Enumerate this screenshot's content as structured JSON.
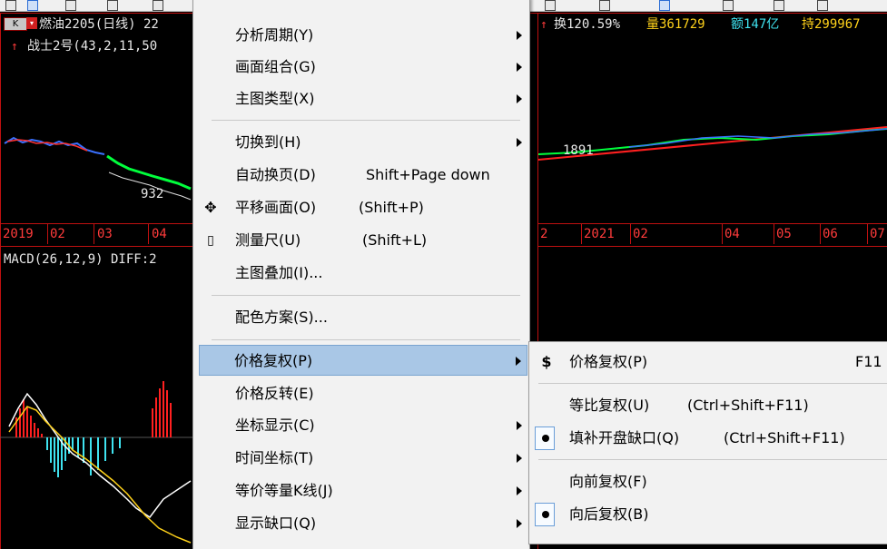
{
  "chart": {
    "kbadge": "K",
    "title_left": "燃油2205(日线) 22",
    "indicator_left": "战士2号(43,2,11,50",
    "stat_turnover": "换120.59%",
    "stat_volume": "量361729",
    "stat_amount": "额147亿",
    "stat_hold": "持299967",
    "price_low_label": "932",
    "price_label_right": "1891",
    "dates_left": [
      "2019",
      "02",
      "03",
      "04"
    ],
    "dates_right": [
      "2",
      "2021",
      "02",
      "04",
      "05",
      "06",
      "07"
    ],
    "macd_label": "MACD(26,12,9) DIFF:2"
  },
  "menu": {
    "items": [
      {
        "label": "分析周期(Y)",
        "submenu": true
      },
      {
        "label": "画面组合(G)",
        "submenu": true
      },
      {
        "label": "主图类型(X)",
        "submenu": true
      },
      {
        "label": "切换到(H)",
        "submenu": true
      },
      {
        "label": "自动换页(D)",
        "shortcut": "Shift+Page down"
      },
      {
        "label": "平移画面(O)",
        "shortcut": "(Shift+P)",
        "icon": "move-icon"
      },
      {
        "label": "测量尺(U)",
        "shortcut": "(Shift+L)",
        "icon": "ruler-icon"
      },
      {
        "label": "主图叠加(I)..."
      },
      {
        "label": "配色方案(S)..."
      },
      {
        "label": "价格复权(P)",
        "submenu": true,
        "highlighted": true
      },
      {
        "label": "价格反转(E)"
      },
      {
        "label": "坐标显示(C)",
        "submenu": true
      },
      {
        "label": "时间坐标(T)",
        "submenu": true
      },
      {
        "label": "等价等量K线(J)",
        "submenu": true
      },
      {
        "label": "显示缺口(Q)",
        "submenu": true
      }
    ]
  },
  "submenu": {
    "items": [
      {
        "label": "价格复权(P)",
        "shortcut": "F11",
        "icon": "$"
      },
      {
        "label": "等比复权(U)",
        "shortcut": "(Ctrl+Shift+F11)"
      },
      {
        "label": "填补开盘缺口(Q)",
        "shortcut": "(Ctrl+Shift+F11)",
        "checked": true
      },
      {
        "label": "向前复权(F)"
      },
      {
        "label": "向后复权(B)",
        "checked": true
      }
    ]
  }
}
